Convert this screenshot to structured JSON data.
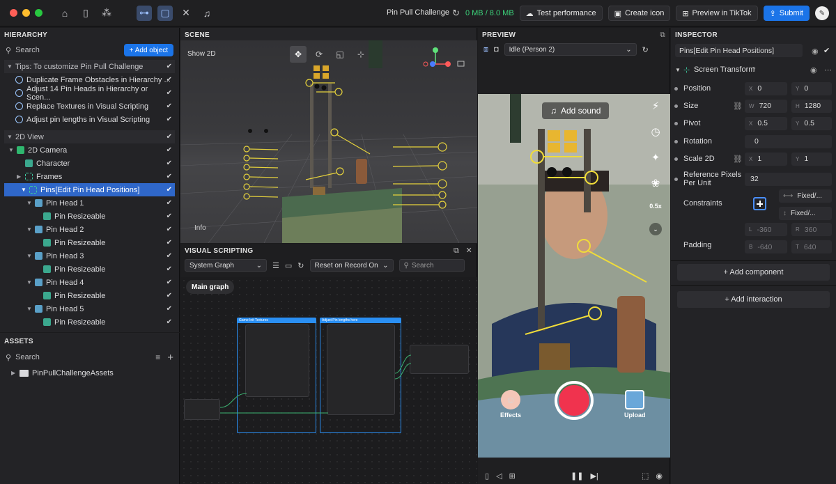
{
  "window": {
    "title": "Pin Pull Challenge",
    "memory": "0 MB / 8.0 MB",
    "buttons": {
      "test_performance": "Test performance",
      "create_icon": "Create icon",
      "preview_tiktok": "Preview in TikTok",
      "submit": "Submit"
    },
    "traffic_colors": [
      "#ff5f57",
      "#febc2e",
      "#28c840"
    ]
  },
  "hierarchy": {
    "title": "HIERARCHY",
    "search_placeholder": "Search",
    "add_object": "+ Add object",
    "tips_group": "Tips: To customize Pin Pull Challenge",
    "tips": [
      "Duplicate Frame Obstacles in Hierarchy ...",
      "Adjust 14 Pin Heads in Hierarchy or Scen...",
      "Replace Textures in Visual Scripting",
      "Adjust pin lengths in Visual Scripting"
    ],
    "view_group": "2D View",
    "items": [
      {
        "label": "2D Camera"
      },
      {
        "label": "Character"
      },
      {
        "label": "Frames"
      },
      {
        "label": "Pins[Edit Pin Head Positions]"
      },
      {
        "label": "Pin Head 1"
      },
      {
        "label": "Pin Resizeable"
      },
      {
        "label": "Pin Head 2"
      },
      {
        "label": "Pin Resizeable"
      },
      {
        "label": "Pin Head 3"
      },
      {
        "label": "Pin Resizeable"
      },
      {
        "label": "Pin Head 4"
      },
      {
        "label": "Pin Resizeable"
      },
      {
        "label": "Pin Head 5"
      },
      {
        "label": "Pin Resizeable"
      }
    ]
  },
  "assets": {
    "title": "ASSETS",
    "search_placeholder": "Search",
    "folder": "PinPullChallengeAssets"
  },
  "scene": {
    "title": "SCENE",
    "show2d": "Show 2D",
    "info": "Info"
  },
  "visual_scripting": {
    "title": "VISUAL SCRIPTING",
    "graph_select": "System Graph",
    "reset_select": "Reset on Record On",
    "search_placeholder": "Search",
    "main_graph": "Main graph"
  },
  "preview": {
    "title": "PREVIEW",
    "select": "Idle (Person 2)",
    "add_sound": "Add sound",
    "effects": "Effects",
    "upload": "Upload",
    "speed": "0.5x"
  },
  "inspector": {
    "title": "INSPECTOR",
    "object_name": "Pins[Edit Pin Head Positions]",
    "component": "Screen Transform",
    "position": {
      "label": "Position",
      "x": "0",
      "y": "0"
    },
    "size": {
      "label": "Size",
      "w": "720",
      "h": "1280"
    },
    "pivot": {
      "label": "Pivot",
      "x": "0.5",
      "y": "0.5"
    },
    "rotation": {
      "label": "Rotation",
      "value": "0"
    },
    "scale2d": {
      "label": "Scale 2D",
      "x": "1",
      "y": "1"
    },
    "ref_pixels": {
      "label": "Reference Pixels Per Unit",
      "value": "32"
    },
    "constraints": {
      "label": "Constraints",
      "h": "Fixed/...",
      "v": "Fixed/..."
    },
    "padding": {
      "label": "Padding",
      "l": "-360",
      "r": "360",
      "b": "-640",
      "t": "640"
    },
    "add_component": "+ Add component",
    "add_interaction": "+ Add interaction"
  }
}
